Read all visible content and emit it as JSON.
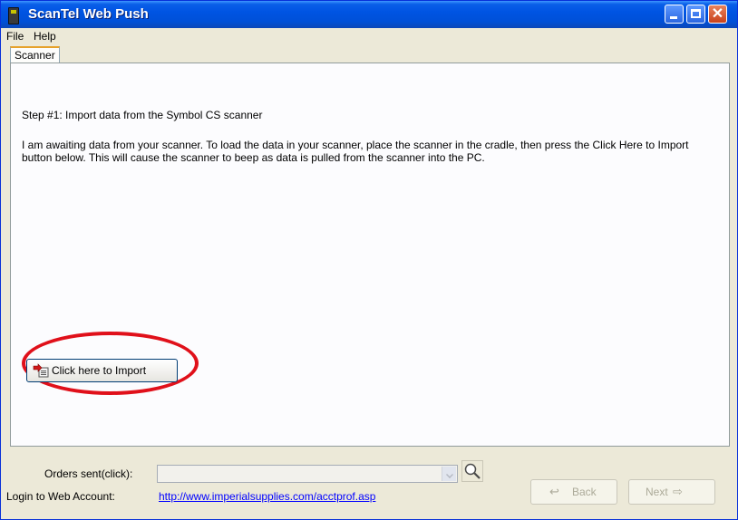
{
  "window": {
    "title": "ScanTel Web Push",
    "close_glyph": "✕"
  },
  "menu": [
    {
      "label": "File"
    },
    {
      "label": "Help"
    }
  ],
  "tabs": [
    {
      "label": "Scanner"
    }
  ],
  "main": {
    "step_title": "Step #1: Import data from the Symbol CS scanner",
    "description": "I am awaiting data from your scanner. To load the data in your scanner, place the scanner in the cradle, then press the Click Here to Import button below. This will cause the scanner to beep as data is pulled from the scanner into the PC.",
    "import_button": "Click here to Import"
  },
  "footer": {
    "orders_label": "Orders sent(click):",
    "orders_value": "",
    "login_label": "Login to Web Account:",
    "login_link": "http://www.imperialsupplies.com/acctprof.asp",
    "back_label": "Back",
    "next_label": "Next",
    "back_icon": "↩",
    "next_icon": "⇨"
  },
  "colors": {
    "titlebar": "#0054e3",
    "annotation": "#e0101a",
    "link": "#0000ff"
  },
  "icons": [
    "app-icon",
    "minimize-icon",
    "maximize-icon",
    "close-icon",
    "import-icon",
    "search-icon",
    "back-arrow-icon",
    "next-arrow-icon"
  ]
}
